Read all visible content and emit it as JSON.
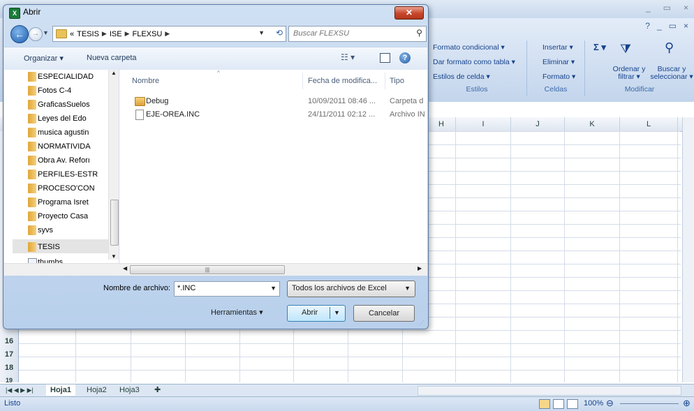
{
  "excel": {
    "window_buttons": [
      "_",
      "▭",
      "×"
    ],
    "ribbon_top_buttons": [
      "?",
      "_",
      "▭",
      "×"
    ],
    "styles_group": {
      "items": [
        "Formato condicional ▾",
        "Dar formato como tabla ▾",
        "Estilos de celda ▾"
      ],
      "label": "Estilos"
    },
    "cells_group": {
      "items": [
        "Insertar ▾",
        "Eliminar ▾",
        "Formato ▾"
      ],
      "label": "Celdas"
    },
    "modify_group": {
      "sort_label": "Ordenar y filtrar ▾",
      "find_label": "Buscar y seleccionar ▾",
      "label": "Modificar"
    },
    "columns": [
      "H",
      "I",
      "J",
      "K",
      "L"
    ],
    "rows": [
      "16",
      "17",
      "18",
      "19"
    ],
    "sheet_tabs": [
      "Hoja1",
      "Hoja2",
      "Hoja3"
    ],
    "status_text": "Listo",
    "zoom_text": "100%"
  },
  "dialog": {
    "title": "Abrir",
    "breadcrumb": [
      "«",
      "TESIS",
      "ISE",
      "FLEXSU"
    ],
    "search_placeholder": "Buscar FLEXSU",
    "toolbar": {
      "organize_label": "Organizar ▾",
      "new_folder_label": "Nueva carpeta"
    },
    "nav_folders": [
      "ESPECIALIDAD",
      "Fotos C-4",
      "GraficasSuelos",
      "Leyes del Edo",
      "musica agustin",
      "NORMATIVIDA",
      "Obra Av. Reforı",
      "PERFILES-ESTR",
      "PROCESO'CON",
      "Programa Isret",
      "Proyecto Casa",
      "syvs",
      "TESIS",
      "thumbs"
    ],
    "selected_folder": "TESIS",
    "columns": {
      "name": "Nombre",
      "date": "Fecha de modifica...",
      "type": "Tipo"
    },
    "files": [
      {
        "name": "Debug",
        "date": "10/09/2011 08:46 ...",
        "type": "Carpeta d",
        "kind": "folder"
      },
      {
        "name": "EJE-OREA.INC",
        "date": "24/11/2011 02:12 ...",
        "type": "Archivo IN",
        "kind": "file"
      }
    ],
    "filename_label": "Nombre de archivo:",
    "filename_value": "*.INC",
    "filetype_value": "Todos los archivos de Excel",
    "tools_label": "Herramientas ▾",
    "open_label": "Abrir",
    "cancel_label": "Cancelar"
  }
}
